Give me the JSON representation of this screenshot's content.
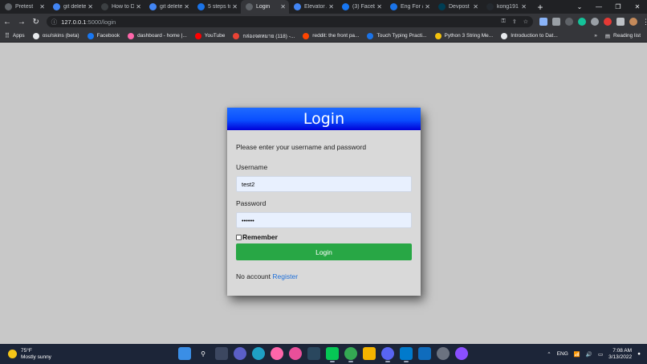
{
  "tabs": [
    {
      "title": "Pretest",
      "color": "#5f6368",
      "active": false
    },
    {
      "title": "git delete",
      "color": "#4285f4",
      "active": false
    },
    {
      "title": "How to D",
      "color": "#3c4043",
      "active": false
    },
    {
      "title": "git delete",
      "color": "#4285f4",
      "active": false
    },
    {
      "title": "5 steps to",
      "color": "#1a73e8",
      "active": false
    },
    {
      "title": "Login",
      "color": "#5f6368",
      "active": true
    },
    {
      "title": "Elevator /",
      "color": "#4285f4",
      "active": false
    },
    {
      "title": "(3) Faceb",
      "color": "#1877f2",
      "active": false
    },
    {
      "title": "Eng For /",
      "color": "#1a73e8",
      "active": false
    },
    {
      "title": "Devpost",
      "color": "#003e54",
      "active": false
    },
    {
      "title": "kong191",
      "color": "#24292f",
      "active": false
    }
  ],
  "address": {
    "host": "127.0.0.1",
    "path": ":5000/login"
  },
  "bookmarks": {
    "apps": "Apps",
    "items": [
      {
        "label": "osu!skins (beta)",
        "color": "#e8eaed"
      },
      {
        "label": "Facebook",
        "color": "#1877f2"
      },
      {
        "label": "dashboard - home |...",
        "color": "#ff66aa"
      },
      {
        "label": "YouTube",
        "color": "#ff0000"
      },
      {
        "label": "กล่องจดหมาย (118) -...",
        "color": "#ea4335"
      },
      {
        "label": "reddit: the front pa...",
        "color": "#ff4500"
      },
      {
        "label": "Touch Typing Practi...",
        "color": "#1a73e8"
      },
      {
        "label": "Python 3 String Me...",
        "color": "#f4c20d"
      },
      {
        "label": "Introduction to Dat...",
        "color": "#e8eaed"
      }
    ],
    "more": "»",
    "reading_list": "Reading list"
  },
  "login": {
    "title": "Login",
    "prompt": "Please enter your username and password",
    "username_label": "Username",
    "username_value": "test2",
    "password_label": "Password",
    "password_value": "••••••",
    "remember_label": "Remember",
    "button_label": "Login",
    "no_account": "No account",
    "register_link": "Register"
  },
  "taskbar": {
    "temperature": "75°F",
    "weather": "Mostly sunny",
    "language": "ENG",
    "time": "7:08 AM",
    "date": "3/13/2022"
  },
  "colors": {
    "header_blue": "#0a4fff",
    "login_button": "#28a745",
    "register_link": "#1e6fd9"
  }
}
